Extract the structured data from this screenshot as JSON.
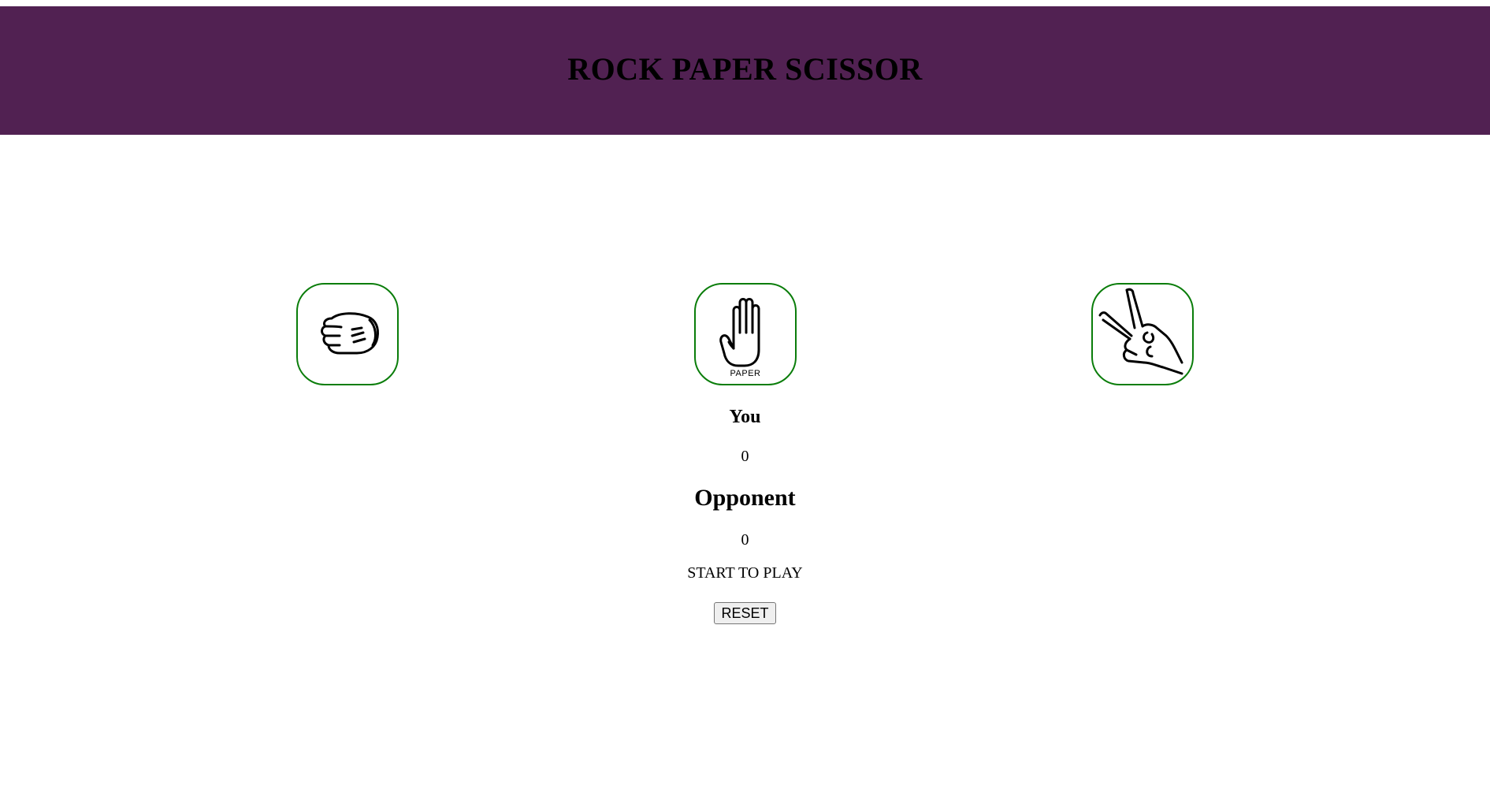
{
  "header": {
    "title": "ROCK PAPER SCISSOR",
    "background": "#512152"
  },
  "choices": [
    {
      "id": "rock",
      "icon": "rock-fist-icon",
      "label": ""
    },
    {
      "id": "paper",
      "icon": "paper-hand-icon",
      "label": "PAPER"
    },
    {
      "id": "scissors",
      "icon": "scissors-hand-icon",
      "label": ""
    }
  ],
  "choice_border_color": "#0a7d0a",
  "scoreboard": {
    "you_label": "You",
    "you_score": "0",
    "opponent_label": "Opponent",
    "opponent_score": "0"
  },
  "status": "START TO PLAY",
  "reset_label": "RESET"
}
